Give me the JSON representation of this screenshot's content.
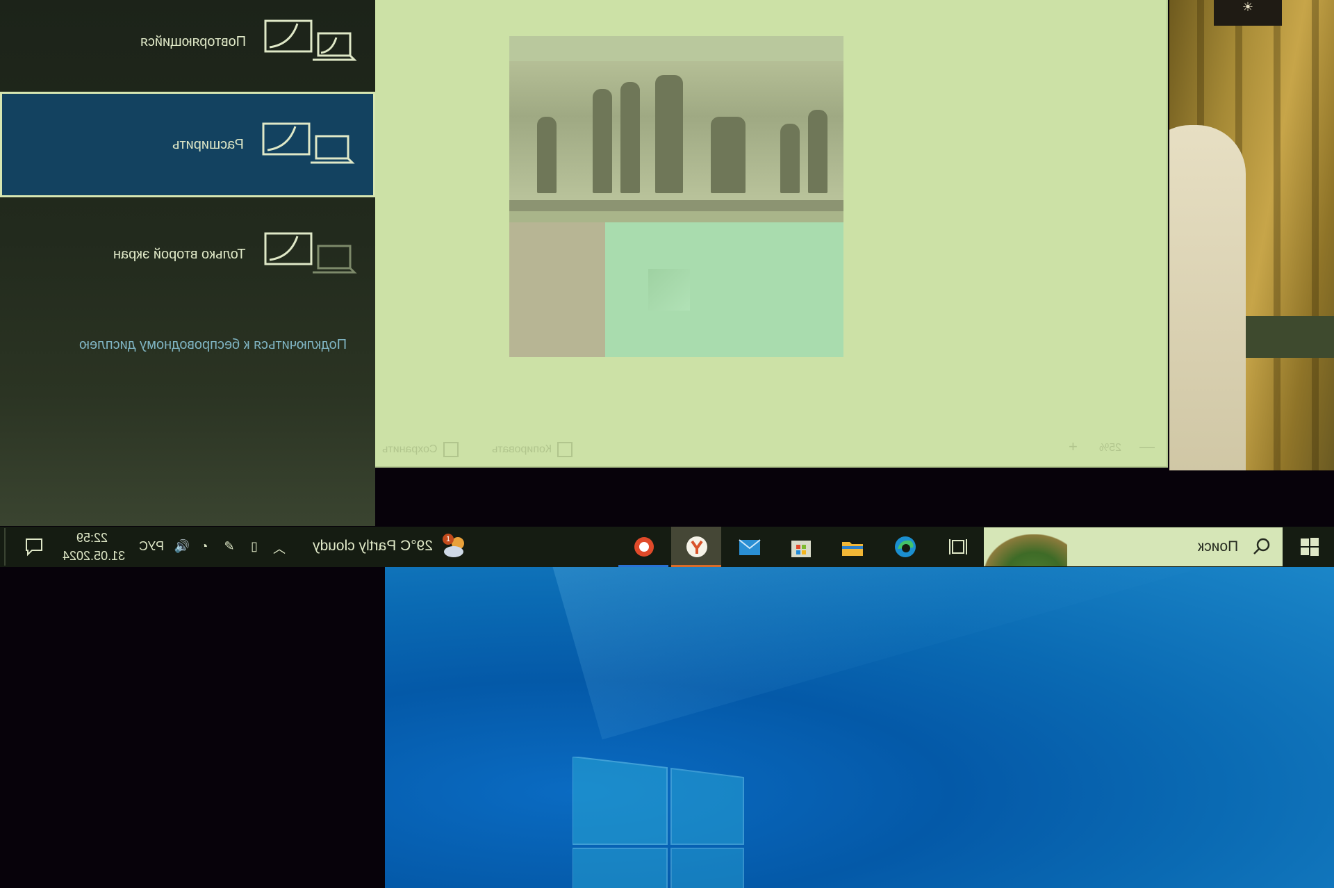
{
  "project_menu": {
    "options": [
      {
        "label": "Повторяющийся"
      },
      {
        "label": "Расширить",
        "selected": true
      },
      {
        "label": "Только второй экран"
      }
    ],
    "wireless_link": "Подключиться к беспроводному дисплею"
  },
  "snip_window": {
    "zoom_minus": "—",
    "zoom_value": "25%",
    "zoom_plus": "+",
    "copy_label": "Копировать",
    "save_label": "Сохранить"
  },
  "taskbar": {
    "clock_time": "22:59",
    "clock_date": "31.05.2024",
    "language": "РУС",
    "weather": "29°C  Partly cloudy",
    "weather_badge": "1",
    "search_placeholder": "Поиск",
    "tray_icons": [
      "chevron-up-icon",
      "battery-icon",
      "pen-icon",
      "wifi-icon",
      "volume-icon"
    ],
    "apps": [
      "task-view",
      "edge",
      "file-explorer",
      "microsoft-store",
      "mail",
      "yandex-browser",
      "yandex-app"
    ]
  },
  "colors": {
    "selected_option": "#134260",
    "selected_border": "#d7e6b1",
    "snip_background": "#cce1a6",
    "taskbar": "#151c12",
    "desktop_blue": "#0459a8"
  }
}
